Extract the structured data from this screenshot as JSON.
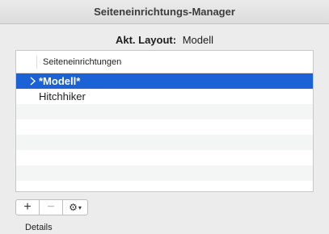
{
  "window": {
    "title": "Seiteneinrichtungs-Manager"
  },
  "layout": {
    "label": "Akt. Layout:",
    "value": "Modell"
  },
  "list": {
    "column_header": "Seiteneinrichtungen",
    "items": [
      {
        "label": "*Modell*",
        "selected": true
      },
      {
        "label": "Hitchhiker",
        "selected": false
      }
    ]
  },
  "toolbar": {
    "add_label": "+",
    "remove_label": "−",
    "gear_label": "⚙",
    "gear_caret": "▾"
  },
  "details": {
    "label": "Details"
  }
}
